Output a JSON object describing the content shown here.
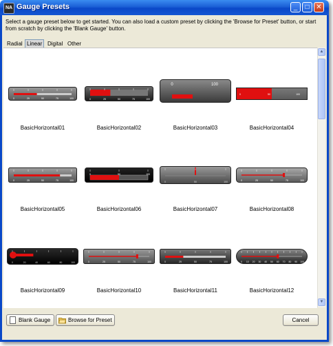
{
  "window": {
    "title": "Gauge Presets",
    "app_icon_text": "NA",
    "minimize_glyph": "_",
    "maximize_glyph": "□",
    "close_glyph": "✕"
  },
  "description": "Select a gauge preset below to get started.  You can also load a custom preset by clicking the 'Browse for Preset' button, or start from scratch by clicking the 'Blank Gauge' button.",
  "tabs": [
    {
      "label": "Radial",
      "active": false
    },
    {
      "label": "Linear",
      "active": true
    },
    {
      "label": "Digital",
      "active": false
    },
    {
      "label": "Other",
      "active": false
    }
  ],
  "presets": [
    {
      "name": "BasicHorizontal01",
      "style": "scale-light",
      "ticks": [
        "0",
        "25",
        "50",
        "75",
        "100"
      ],
      "value": 0.4
    },
    {
      "name": "BasicHorizontal02",
      "style": "bar-red",
      "ticks": [
        "0",
        "25",
        "50",
        "75",
        "100"
      ],
      "value": 0.35
    },
    {
      "name": "BasicHorizontal03",
      "style": "big-dark",
      "ticks": [
        "0",
        "100"
      ],
      "value": 0.3
    },
    {
      "name": "BasicHorizontal04",
      "style": "flat-red",
      "ticks": [
        "0",
        "50",
        "100"
      ],
      "value": 0.5
    },
    {
      "name": "BasicHorizontal05",
      "style": "dark-red",
      "ticks": [
        "0",
        "25",
        "50",
        "75",
        "100"
      ],
      "value": 0.8
    },
    {
      "name": "BasicHorizontal06",
      "style": "black-box",
      "ticks": [
        "0",
        "50",
        "100"
      ],
      "value": 0.5
    },
    {
      "name": "BasicHorizontal07",
      "style": "grey-pointer",
      "ticks": [
        "0",
        "50",
        "100"
      ],
      "value": 0.5
    },
    {
      "name": "BasicHorizontal08",
      "style": "grey-scale",
      "ticks": [
        "0",
        "25",
        "50",
        "75",
        "100"
      ],
      "value": 0.7
    },
    {
      "name": "BasicHorizontal09",
      "style": "thermo",
      "ticks": [
        "0",
        "20",
        "40",
        "60",
        "80",
        "100"
      ],
      "value": 0.35
    },
    {
      "name": "BasicHorizontal10",
      "style": "grey-bar",
      "ticks": [
        "0",
        "25",
        "50",
        "75",
        "100"
      ],
      "value": 0.8
    },
    {
      "name": "BasicHorizontal11",
      "style": "dark-bar",
      "ticks": [
        "0",
        "25",
        "50",
        "75",
        "100"
      ],
      "value": 0.3
    },
    {
      "name": "BasicHorizontal12",
      "style": "pill",
      "ticks": [
        "0",
        "10",
        "20",
        "30",
        "40",
        "50",
        "60",
        "70",
        "80",
        "90",
        "100"
      ],
      "value": 0.6
    }
  ],
  "buttons": {
    "blank_gauge": "Blank Gauge",
    "browse": "Browse for Preset",
    "cancel": "Cancel"
  },
  "colors": {
    "title_bar": "#1a5fd6",
    "accent_red": "#e01010",
    "gauge_dark": "#3a3a3a"
  }
}
